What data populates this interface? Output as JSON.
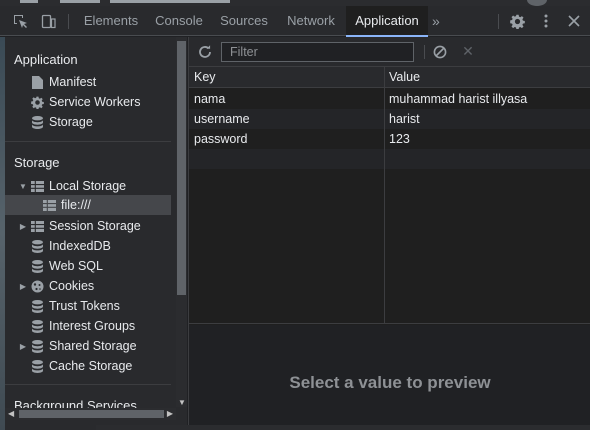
{
  "devtools": {
    "tabs": [
      {
        "label": "Elements"
      },
      {
        "label": "Console"
      },
      {
        "label": "Sources"
      },
      {
        "label": "Network"
      },
      {
        "label": "Application",
        "active": true
      }
    ],
    "more_tabs_label": "»",
    "icons": {
      "inspect": "inspect-element-icon",
      "device": "device-toolbar-icon",
      "settings": "gear-icon",
      "menu": "kebab-menu-icon",
      "close": "close-icon"
    }
  },
  "sidebar": {
    "application_title": "Application",
    "application_items": [
      {
        "label": "Manifest",
        "icon": "file-icon"
      },
      {
        "label": "Service Workers",
        "icon": "gear-icon"
      },
      {
        "label": "Storage",
        "icon": "database-icon"
      }
    ],
    "storage_title": "Storage",
    "storage_items": [
      {
        "label": "Local Storage",
        "icon": "grid-icon",
        "expanded": true
      },
      {
        "label": "file:///",
        "icon": "grid-icon",
        "selected": true
      },
      {
        "label": "Session Storage",
        "icon": "grid-icon",
        "expanded": false
      },
      {
        "label": "IndexedDB",
        "icon": "database-icon"
      },
      {
        "label": "Web SQL",
        "icon": "database-icon"
      },
      {
        "label": "Cookies",
        "icon": "cookie-icon",
        "expanded": false
      },
      {
        "label": "Trust Tokens",
        "icon": "database-icon"
      },
      {
        "label": "Interest Groups",
        "icon": "database-icon"
      },
      {
        "label": "Shared Storage",
        "icon": "database-icon",
        "expanded": false
      },
      {
        "label": "Cache Storage",
        "icon": "database-icon"
      }
    ],
    "background_title": "Background Services"
  },
  "main": {
    "filter_placeholder": "Filter",
    "columns": {
      "key": "Key",
      "value": "Value"
    },
    "rows": [
      {
        "key": "nama",
        "value": "muhammad harist illyasa"
      },
      {
        "key": "username",
        "value": "harist"
      },
      {
        "key": "password",
        "value": "123"
      }
    ],
    "preview_text": "Select a value to preview"
  },
  "colors": {
    "accent": "#8ab4f8",
    "panel_bg": "#1f1f1f",
    "toolbar_bg": "#292a2d",
    "text": "#e8eaed",
    "muted": "#9aa0a6"
  }
}
